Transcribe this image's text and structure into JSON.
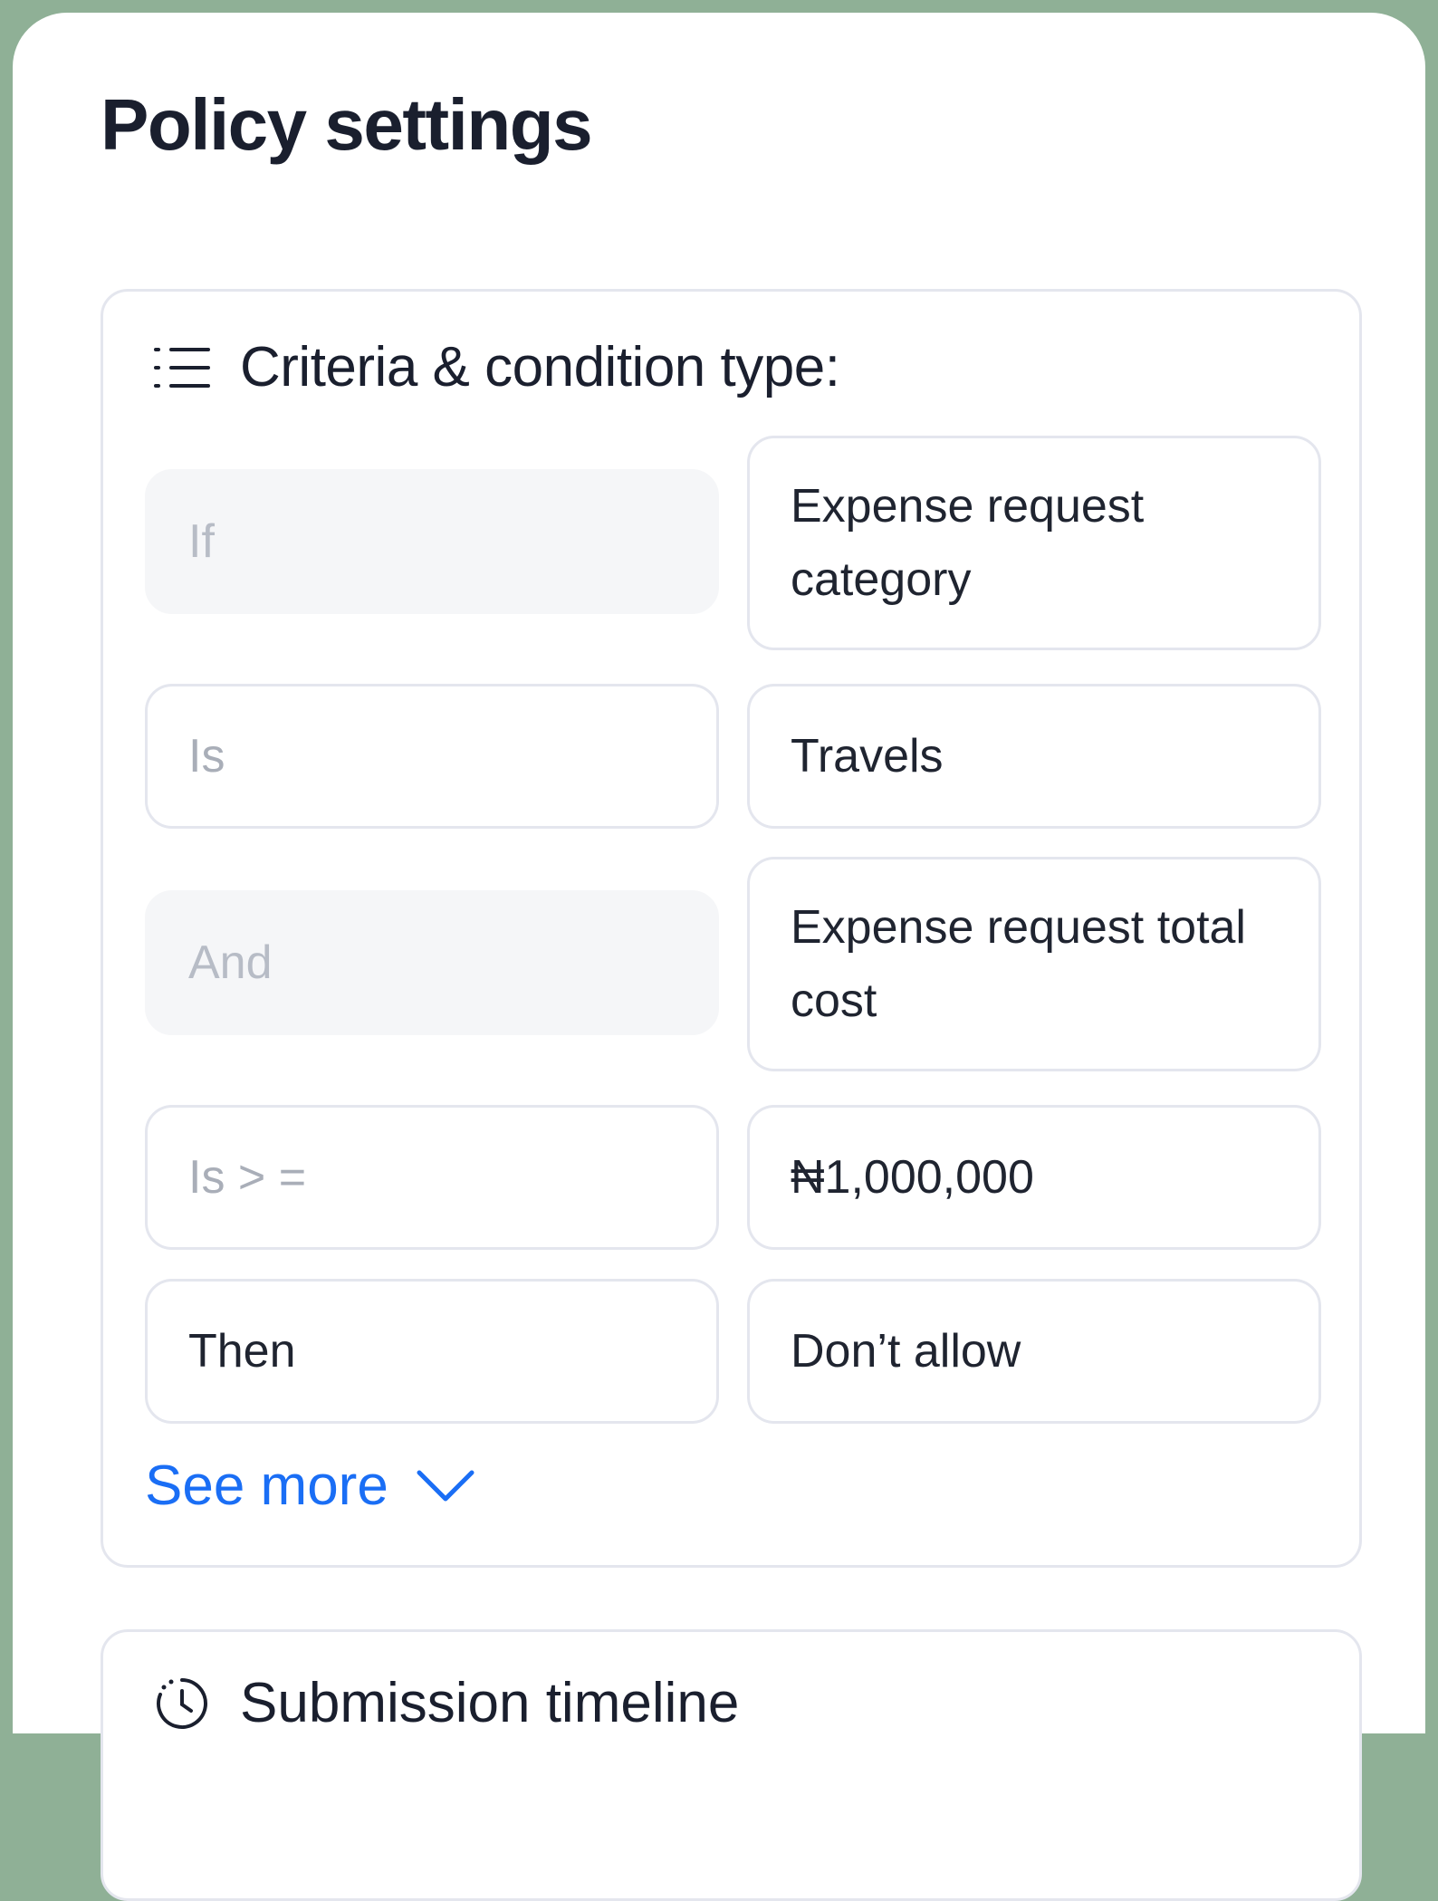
{
  "page": {
    "title": "Policy settings"
  },
  "criteria": {
    "icon": "list-icon",
    "title": "Criteria & condition type:",
    "rows": [
      {
        "operator": "If",
        "value": "Expense request category"
      },
      {
        "operator": "Is",
        "value": "Travels"
      },
      {
        "operator": "And",
        "value": "Expense request total cost"
      },
      {
        "operator": "Is > =",
        "value": "₦1,000,000"
      },
      {
        "operator": "Then",
        "value": "Don’t allow"
      }
    ],
    "see_more": {
      "label": "See more",
      "icon": "chevron-down-icon"
    }
  },
  "next_section": {
    "icon": "clock-icon",
    "title": "Submission timeline"
  },
  "colors": {
    "frame": "#8fb096",
    "link": "#1a6ef5",
    "border": "#e4e6ee",
    "filled_field": "#f5f6f8",
    "text": "#1a1f2e"
  }
}
